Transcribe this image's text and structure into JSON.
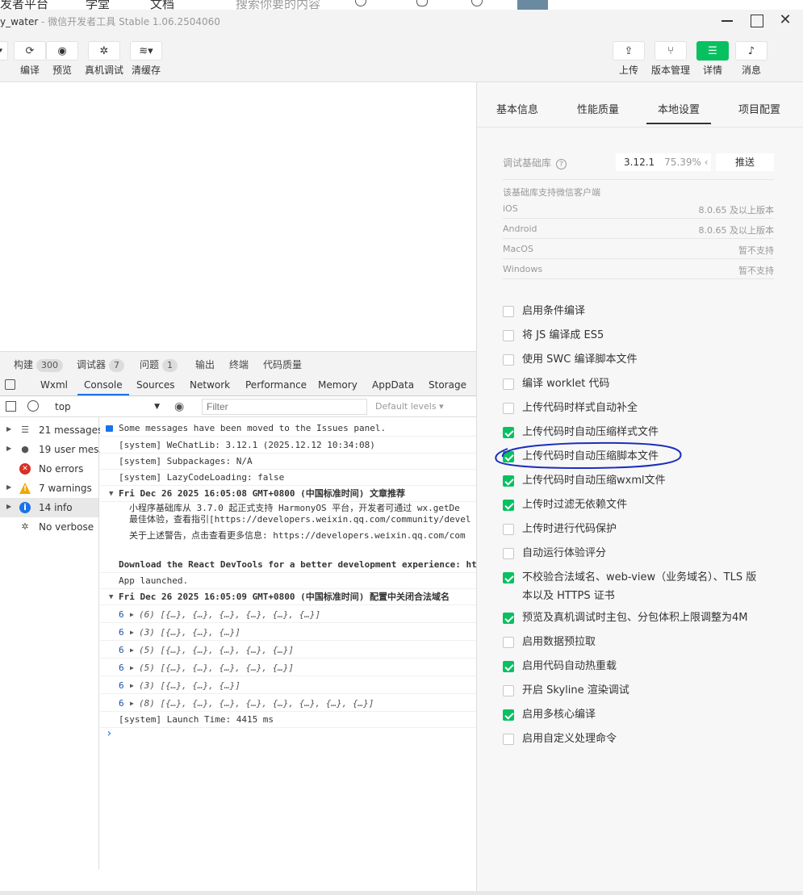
{
  "browser_tabs": [
    "发者平台",
    "学堂",
    "文档",
    "搜索你要的内容"
  ],
  "window": {
    "project": "y_water",
    "separator": " - ",
    "app_title": "微信开发者工具 Stable 1.06.2504060",
    "min": "—",
    "max": "□",
    "close": "✕"
  },
  "toolbar_left": [
    {
      "label": "编译",
      "icon": "refresh-icon",
      "glyph": "⟳"
    },
    {
      "label": "预览",
      "icon": "eye-icon",
      "glyph": "◉"
    },
    {
      "label": "真机调试",
      "icon": "bug-icon",
      "glyph": "✲"
    },
    {
      "label": "清缓存",
      "icon": "layers-icon",
      "glyph": "≋▾"
    }
  ],
  "toolbar_right": [
    {
      "label": "上传",
      "icon": "upload-icon",
      "glyph": "⇪"
    },
    {
      "label": "版本管理",
      "icon": "branch-icon",
      "glyph": "⑂"
    },
    {
      "label": "详情",
      "icon": "menu-icon",
      "glyph": "☰"
    },
    {
      "label": "消息",
      "icon": "bell-icon",
      "glyph": "♪"
    }
  ],
  "debug_tabs": [
    {
      "label": "构建",
      "count": "300"
    },
    {
      "label": "调试器",
      "count": "7"
    },
    {
      "label": "问题",
      "count": "1"
    },
    {
      "label": "输出",
      "count": ""
    },
    {
      "label": "终端",
      "count": ""
    },
    {
      "label": "代码质量",
      "count": ""
    }
  ],
  "devtools_tabs": [
    "Wxml",
    "Console",
    "Sources",
    "Network",
    "Performance",
    "Memory",
    "AppData",
    "Storage"
  ],
  "devtools_active": "Console",
  "filter": {
    "context": "top",
    "placeholder": "Filter",
    "levels": "Default levels ▾"
  },
  "sidebar": [
    {
      "label": "21 messages",
      "icon": "list-icon",
      "glyph": "☰",
      "color": "#555"
    },
    {
      "label": "19 user mes...",
      "icon": "user-icon",
      "glyph": "●",
      "color": "#555"
    },
    {
      "label": "No errors",
      "icon": "error-icon",
      "glyph": "✕",
      "color": "#d93025"
    },
    {
      "label": "7 warnings",
      "icon": "warning-icon",
      "glyph": "!",
      "color": "#f2a600"
    },
    {
      "label": "14 info",
      "icon": "info-icon",
      "glyph": "i",
      "color": "#1a73e8"
    },
    {
      "label": "No verbose",
      "icon": "bug-icon",
      "glyph": "✲",
      "color": "#555"
    }
  ],
  "console_lines": [
    {
      "text": "Some messages have been moved to the Issues panel.",
      "kind": "note"
    },
    {
      "text": "[system] WeChatLib: 3.12.1 (2025.12.12 10:34:08)",
      "kind": "plain"
    },
    {
      "text": "[system] Subpackages: N/A",
      "kind": "plain"
    },
    {
      "text": "[system] LazyCodeLoading: false",
      "kind": "plain"
    },
    {
      "text": "Fri Dec 26 2025 16:05:08 GMT+0800 (中国标准时间) 文章推荐",
      "kind": "group"
    },
    {
      "text": "小程序基础库从 3.7.0 起正式支持 HarmonyOS 平台，开发者可通过 wx.getDe",
      "kind": "indent"
    },
    {
      "text": "最佳体验，查看指引[https://developers.weixin.qq.com/community/devel",
      "kind": "indent"
    },
    {
      "text": "关于上述警告，点击查看更多信息: https://developers.weixin.qq.com/com",
      "kind": "indent"
    },
    {
      "text": "Download the React DevTools for a better development experience: ht",
      "kind": "bold"
    },
    {
      "text": "App launched.",
      "kind": "plain"
    },
    {
      "text": "Fri Dec 26 2025 16:05:09 GMT+0800 (中国标准时间) 配置中关闭合法域名",
      "kind": "group"
    },
    {
      "text": "(6) [{…}, {…}, {…}, {…}, {…}, {…}]",
      "kind": "obj",
      "count": "6"
    },
    {
      "text": "(3) [{…}, {…}, {…}]",
      "kind": "obj",
      "count": "6"
    },
    {
      "text": "(5) [{…}, {…}, {…}, {…}, {…}]",
      "kind": "obj",
      "count": "6"
    },
    {
      "text": "(5) [{…}, {…}, {…}, {…}, {…}]",
      "kind": "obj",
      "count": "6"
    },
    {
      "text": "(3) [{…}, {…}, {…}]",
      "kind": "obj",
      "count": "6"
    },
    {
      "text": "(8) [{…}, {…}, {…}, {…}, {…}, {…}, {…}, {…}]",
      "kind": "obj",
      "count": "6"
    },
    {
      "text": "[system] Launch Time: 4415 ms",
      "kind": "plain"
    }
  ],
  "prompt": "›",
  "right_tabs": [
    "基本信息",
    "性能质量",
    "本地设置",
    "项目配置"
  ],
  "right_active": "本地设置",
  "settings": {
    "lib_label": "调试基础库",
    "lib_version": "3.12.1",
    "lib_percent": "75.39% ‹",
    "push_label": "推送",
    "support_title": "该基础库支持微信客户端",
    "support": [
      {
        "os": "iOS",
        "ver": "8.0.65 及以上版本"
      },
      {
        "os": "Android",
        "ver": "8.0.65 及以上版本"
      },
      {
        "os": "MacOS",
        "ver": "暂不支持"
      },
      {
        "os": "Windows",
        "ver": "暂不支持"
      }
    ]
  },
  "checkboxes": [
    {
      "label": "启用条件编译",
      "checked": false
    },
    {
      "label": "将 JS 编译成 ES5",
      "checked": false
    },
    {
      "label": "使用 SWC 编译脚本文件",
      "checked": false
    },
    {
      "label": "编译 worklet 代码",
      "checked": false
    },
    {
      "label": "上传代码时样式自动补全",
      "checked": false
    },
    {
      "label": "上传代码时自动压缩样式文件",
      "checked": true
    },
    {
      "label": "上传代码时自动压缩脚本文件",
      "checked": true
    },
    {
      "label": "上传代码时自动压缩wxml文件",
      "checked": true
    },
    {
      "label": "上传时过滤无依赖文件",
      "checked": true
    },
    {
      "label": "上传时进行代码保护",
      "checked": false
    },
    {
      "label": "自动运行体验评分",
      "checked": false
    },
    {
      "label": "不校验合法域名、web-view（业务域名）、TLS 版",
      "label2": "本以及 HTTPS 证书",
      "checked": true
    },
    {
      "label": "预览及真机调试时主包、分包体积上限调整为4M",
      "checked": true
    },
    {
      "label": "启用数据预拉取",
      "checked": false
    },
    {
      "label": "启用代码自动热重载",
      "checked": true
    },
    {
      "label": "开启 Skyline 渲染调试",
      "checked": false
    },
    {
      "label": "启用多核心编译",
      "checked": true
    },
    {
      "label": "启用自定义处理命令",
      "checked": false
    }
  ],
  "colors": {
    "accent": "#07c160",
    "annotation": "#1a2fbf",
    "link": "#1a73e8"
  }
}
